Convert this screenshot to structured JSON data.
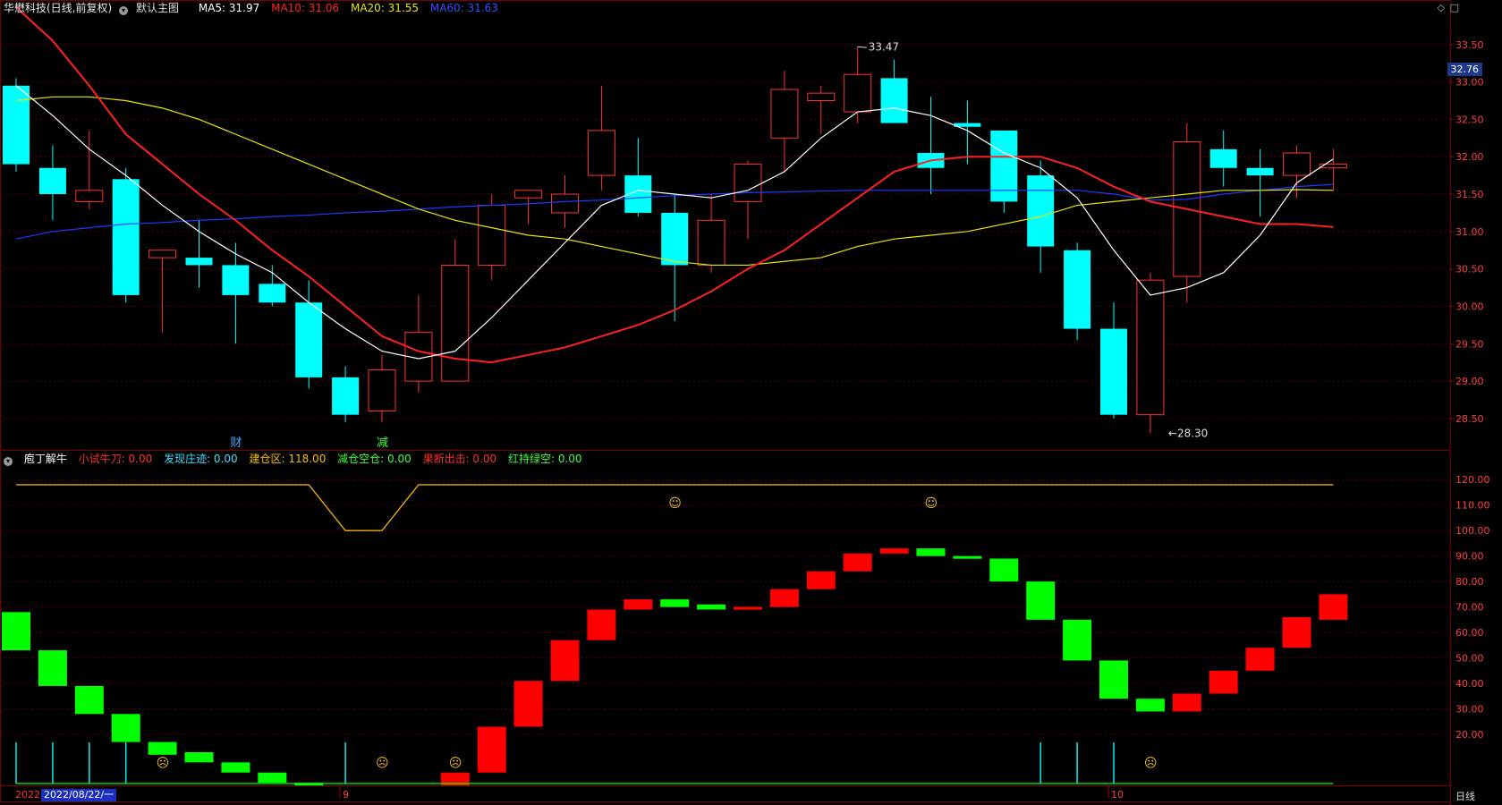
{
  "header_main": {
    "stock": "华懋科技(日线,前复权)",
    "template": "默认主图",
    "ma5": "MA5: 31.97",
    "ma10": "MA10: 31.06",
    "ma20": "MA20: 31.55",
    "ma60": "MA60: 31.63"
  },
  "header_sub": {
    "name": "庖丁解牛",
    "ind1": "小试牛刀: 0.00",
    "ind2": "发现庄迹: 0.00",
    "ind3": "建仓区: 118.00",
    "ind4": "减仓空仓: 0.00",
    "ind5": "果断出击: 0.00",
    "ind6": "红持绿空: 0.00"
  },
  "colors": {
    "up": "#ff3232",
    "down": "#00ffff",
    "ma5": "#ffffff",
    "ma10": "#ff2020",
    "ma20": "#e8e800",
    "ma60": "#1a3cff",
    "zone": "#f0b000",
    "bar_red": "#ff0000",
    "bar_green": "#00ff00",
    "grid": "#5a0000",
    "axis_text": "#ff4040"
  },
  "price_axis": [
    "33.50",
    "33.00",
    "32.50",
    "32.00",
    "31.50",
    "31.00",
    "30.50",
    "30.00",
    "29.50",
    "29.00",
    "28.50"
  ],
  "price_range": [
    28.08,
    33.88
  ],
  "current_price_tag": "32.76",
  "high_label": "33.47",
  "low_label": "28.30",
  "events": [
    {
      "label": "财",
      "color": "#4aa8ff"
    },
    {
      "label": "减",
      "color": "#40ff40"
    }
  ],
  "sub_axis": [
    "120.00",
    "110.00",
    "100.00",
    "90.00",
    "80.00",
    "70.00",
    "60.00",
    "50.00",
    "40.00",
    "30.00",
    "20.00"
  ],
  "sub_range": [
    0,
    125
  ],
  "date_axis": {
    "year": "2022",
    "cursor_date": "2022/08/22/一",
    "month9": "9",
    "month10": "10",
    "period": "日线"
  },
  "corner_icons": [
    "diamond-icon",
    "square-icon"
  ],
  "candles": [
    {
      "o": 32.95,
      "h": 33.05,
      "l": 31.8,
      "c": 31.9
    },
    {
      "o": 31.85,
      "h": 32.15,
      "l": 31.15,
      "c": 31.5
    },
    {
      "o": 31.4,
      "h": 32.35,
      "l": 31.3,
      "c": 31.55
    },
    {
      "o": 31.7,
      "h": 31.85,
      "l": 30.05,
      "c": 30.15
    },
    {
      "o": 30.65,
      "h": 30.75,
      "l": 29.65,
      "c": 30.75
    },
    {
      "o": 30.65,
      "h": 31.15,
      "l": 30.25,
      "c": 30.55
    },
    {
      "o": 30.55,
      "h": 30.85,
      "l": 29.5,
      "c": 30.15
    },
    {
      "o": 30.3,
      "h": 30.55,
      "l": 30.0,
      "c": 30.05
    },
    {
      "o": 30.05,
      "h": 30.35,
      "l": 28.9,
      "c": 29.05
    },
    {
      "o": 29.05,
      "h": 29.2,
      "l": 28.45,
      "c": 28.55
    },
    {
      "o": 28.6,
      "h": 29.35,
      "l": 28.45,
      "c": 29.15
    },
    {
      "o": 29.0,
      "h": 30.15,
      "l": 28.85,
      "c": 29.65
    },
    {
      "o": 29.0,
      "h": 30.9,
      "l": 29.5,
      "c": 30.55
    },
    {
      "o": 30.55,
      "h": 31.5,
      "l": 30.35,
      "c": 31.35
    },
    {
      "o": 31.45,
      "h": 31.55,
      "l": 31.1,
      "c": 31.55
    },
    {
      "o": 31.25,
      "h": 31.75,
      "l": 31.05,
      "c": 31.5
    },
    {
      "o": 31.75,
      "h": 32.95,
      "l": 31.55,
      "c": 32.35
    },
    {
      "o": 31.75,
      "h": 32.25,
      "l": 31.2,
      "c": 31.25
    },
    {
      "o": 31.25,
      "h": 31.5,
      "l": 29.8,
      "c": 30.55
    },
    {
      "o": 30.55,
      "h": 31.5,
      "l": 30.45,
      "c": 31.15
    },
    {
      "o": 31.4,
      "h": 31.95,
      "l": 30.9,
      "c": 31.9
    },
    {
      "o": 32.25,
      "h": 33.15,
      "l": 31.8,
      "c": 32.9
    },
    {
      "o": 32.75,
      "h": 32.95,
      "l": 32.3,
      "c": 32.85
    },
    {
      "o": 32.6,
      "h": 33.47,
      "l": 32.45,
      "c": 33.1
    },
    {
      "o": 33.05,
      "h": 33.3,
      "l": 32.45,
      "c": 32.45
    },
    {
      "o": 32.05,
      "h": 32.8,
      "l": 31.5,
      "c": 31.85
    },
    {
      "o": 32.45,
      "h": 32.75,
      "l": 31.9,
      "c": 32.4
    },
    {
      "o": 32.35,
      "h": 32.35,
      "l": 31.25,
      "c": 31.4
    },
    {
      "o": 31.75,
      "h": 31.95,
      "l": 30.45,
      "c": 30.8
    },
    {
      "o": 30.75,
      "h": 30.85,
      "l": 29.55,
      "c": 29.7
    },
    {
      "o": 29.7,
      "h": 30.05,
      "l": 28.5,
      "c": 28.55
    },
    {
      "o": 28.55,
      "h": 30.45,
      "l": 28.3,
      "c": 30.35
    },
    {
      "o": 30.4,
      "h": 32.45,
      "l": 30.05,
      "c": 32.2
    },
    {
      "o": 32.1,
      "h": 32.35,
      "l": 31.6,
      "c": 31.85
    },
    {
      "o": 31.85,
      "h": 32.1,
      "l": 31.2,
      "c": 31.75
    },
    {
      "o": 31.75,
      "h": 32.15,
      "l": 31.45,
      "c": 32.05
    },
    {
      "o": 31.85,
      "h": 32.1,
      "l": 31.55,
      "c": 31.9
    }
  ],
  "ma5": [
    32.95,
    32.55,
    32.1,
    31.75,
    31.35,
    31.0,
    30.7,
    30.45,
    30.05,
    29.7,
    29.4,
    29.3,
    29.4,
    29.85,
    30.35,
    30.85,
    31.35,
    31.55,
    31.5,
    31.45,
    31.55,
    31.8,
    32.25,
    32.6,
    32.65,
    32.55,
    32.35,
    32.05,
    31.85,
    31.45,
    30.75,
    30.15,
    30.25,
    30.45,
    30.95,
    31.65,
    31.97
  ],
  "ma10": [
    34.0,
    33.55,
    32.95,
    32.3,
    31.9,
    31.5,
    31.15,
    30.75,
    30.4,
    30.0,
    29.6,
    29.4,
    29.3,
    29.25,
    29.35,
    29.45,
    29.6,
    29.75,
    29.95,
    30.2,
    30.5,
    30.75,
    31.1,
    31.45,
    31.8,
    31.95,
    32.0,
    32.0,
    32.0,
    31.85,
    31.6,
    31.4,
    31.3,
    31.2,
    31.1,
    31.1,
    31.06
  ],
  "ma20": [
    32.75,
    32.8,
    32.8,
    32.75,
    32.65,
    32.5,
    32.3,
    32.1,
    31.9,
    31.7,
    31.5,
    31.3,
    31.15,
    31.05,
    30.95,
    30.9,
    30.8,
    30.7,
    30.6,
    30.55,
    30.55,
    30.6,
    30.65,
    30.8,
    30.9,
    30.95,
    31.0,
    31.1,
    31.2,
    31.35,
    31.4,
    31.45,
    31.5,
    31.55,
    31.55,
    31.56,
    31.55
  ],
  "ma60": [
    30.9,
    31.0,
    31.05,
    31.1,
    31.12,
    31.15,
    31.17,
    31.2,
    31.22,
    31.25,
    31.27,
    31.3,
    31.33,
    31.35,
    31.37,
    31.4,
    31.42,
    31.45,
    31.48,
    31.5,
    31.52,
    31.53,
    31.54,
    31.55,
    31.55,
    31.55,
    31.55,
    31.55,
    31.55,
    31.55,
    31.5,
    31.42,
    31.43,
    31.5,
    31.55,
    31.6,
    31.63
  ],
  "zone_line": [
    118,
    118,
    118,
    118,
    118,
    118,
    118,
    118,
    118,
    100,
    100,
    118,
    118,
    118,
    118,
    118,
    118,
    118,
    118,
    118,
    118,
    118,
    118,
    118,
    118,
    118,
    118,
    118,
    118,
    118,
    118,
    118,
    118,
    118,
    118,
    118,
    118
  ],
  "blocks": [
    {
      "lo": 53,
      "hi": 68,
      "c": "g"
    },
    {
      "lo": 39,
      "hi": 53,
      "c": "g"
    },
    {
      "lo": 28,
      "hi": 39,
      "c": "g"
    },
    {
      "lo": 17,
      "hi": 28,
      "c": "g"
    },
    {
      "lo": 12,
      "hi": 17,
      "c": "g"
    },
    {
      "lo": 9,
      "hi": 13,
      "c": "g"
    },
    {
      "lo": 5,
      "hi": 9,
      "c": "g"
    },
    {
      "lo": 1,
      "hi": 5,
      "c": "g"
    },
    {
      "lo": 0,
      "hi": 1,
      "c": "g"
    },
    null,
    null,
    null,
    {
      "lo": 0,
      "hi": 5,
      "c": "r"
    },
    {
      "lo": 5,
      "hi": 23,
      "c": "r"
    },
    {
      "lo": 23,
      "hi": 41,
      "c": "r"
    },
    {
      "lo": 41,
      "hi": 57,
      "c": "r"
    },
    {
      "lo": 57,
      "hi": 69,
      "c": "r"
    },
    {
      "lo": 69,
      "hi": 73,
      "c": "r"
    },
    {
      "lo": 70,
      "hi": 73,
      "c": "g"
    },
    {
      "lo": 69,
      "hi": 71,
      "c": "g"
    },
    {
      "lo": 69,
      "hi": 70,
      "c": "r"
    },
    {
      "lo": 70,
      "hi": 77,
      "c": "r"
    },
    {
      "lo": 77,
      "hi": 84,
      "c": "r"
    },
    {
      "lo": 84,
      "hi": 91,
      "c": "r"
    },
    {
      "lo": 91,
      "hi": 93,
      "c": "r"
    },
    {
      "lo": 90,
      "hi": 93,
      "c": "g"
    },
    {
      "lo": 89,
      "hi": 90,
      "c": "g"
    },
    {
      "lo": 80,
      "hi": 89,
      "c": "g"
    },
    {
      "lo": 65,
      "hi": 80,
      "c": "g"
    },
    {
      "lo": 49,
      "hi": 65,
      "c": "g"
    },
    {
      "lo": 34,
      "hi": 49,
      "c": "g"
    },
    {
      "lo": 29,
      "hi": 34,
      "c": "g"
    },
    {
      "lo": 29,
      "hi": 36,
      "c": "r"
    },
    {
      "lo": 36,
      "hi": 45,
      "c": "r"
    },
    {
      "lo": 45,
      "hi": 54,
      "c": "r"
    },
    {
      "lo": 54,
      "hi": 66,
      "c": "r"
    },
    {
      "lo": 65,
      "hi": 75,
      "c": "r"
    }
  ],
  "cyan_ticks": [
    0,
    1,
    2,
    3,
    9,
    28,
    29,
    30
  ],
  "frown_marks": [
    4,
    10,
    12,
    31
  ],
  "smile_marks": [
    18,
    25
  ],
  "month_labels": [
    {
      "i": 9,
      "key": "month9"
    },
    {
      "i": 30,
      "key": "month10"
    }
  ]
}
